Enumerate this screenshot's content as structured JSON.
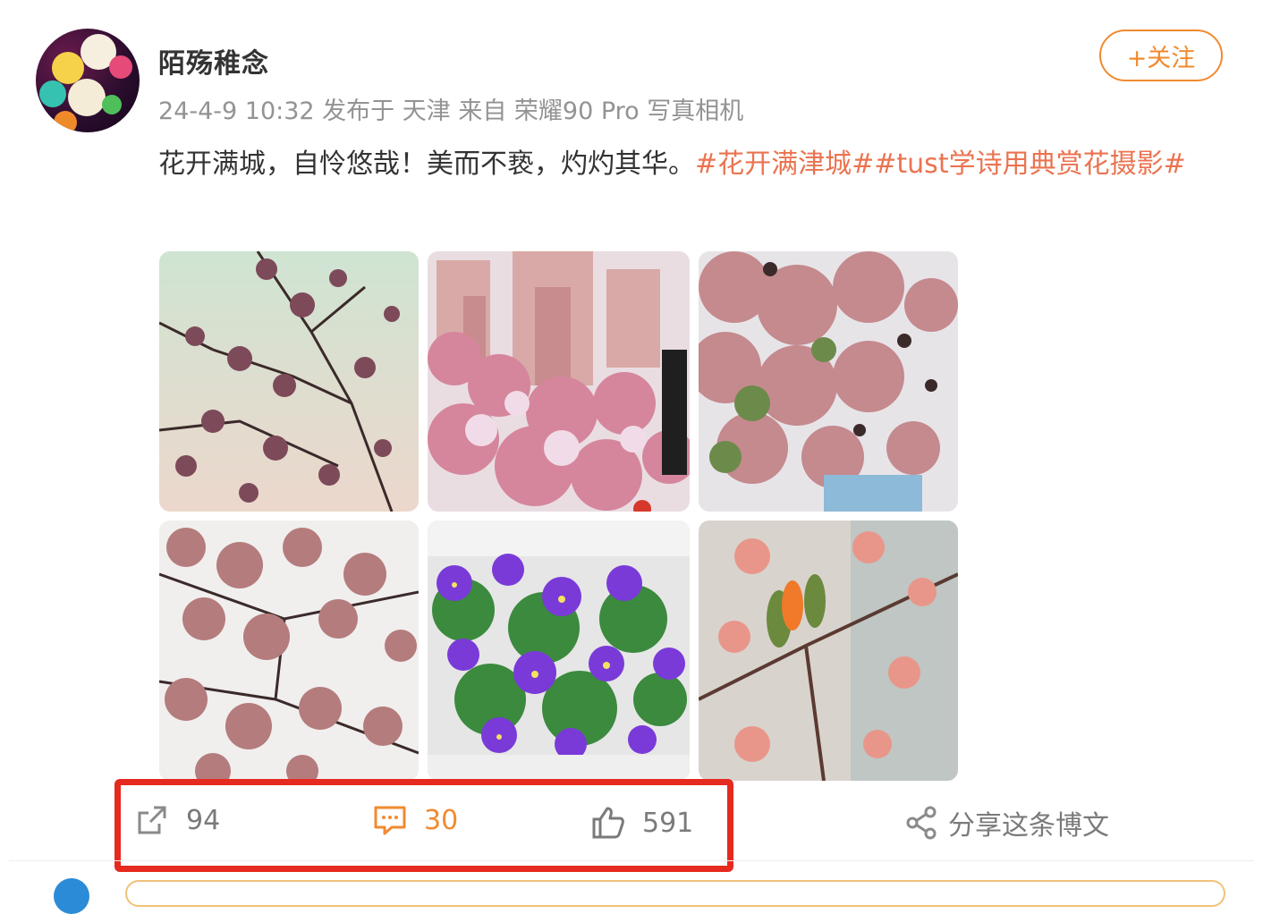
{
  "post": {
    "author": "陌殇稚念",
    "meta": "24-4-9 10:32 发布于 天津 来自 荣耀90 Pro 写真相机",
    "follow_label": "+关注",
    "text_plain": "花开满城，自怜悠哉！美而不亵，灼灼其华。",
    "hashtags": "#花开满津城##tust学诗用典赏花摄影#",
    "images": [
      {
        "name": "photo-1",
        "subject": "pink blossoms branches against pale sky"
      },
      {
        "name": "photo-2",
        "subject": "pink blossom trees with high-rise buildings"
      },
      {
        "name": "photo-3",
        "subject": "crabapple blossoms with green leaves"
      },
      {
        "name": "photo-4",
        "subject": "dense blossom branches"
      },
      {
        "name": "photo-5",
        "subject": "purple pansies in planter"
      },
      {
        "name": "photo-6",
        "subject": "peach blossom buds close-up"
      }
    ]
  },
  "actions": {
    "repost_count": "94",
    "comment_count": "30",
    "like_count": "591",
    "share_label": "分享这条博文"
  },
  "colors": {
    "accent": "#f18a2f",
    "hashtag": "#eb7350",
    "highlight": "#e52a1f",
    "meta_gray": "#939393"
  }
}
